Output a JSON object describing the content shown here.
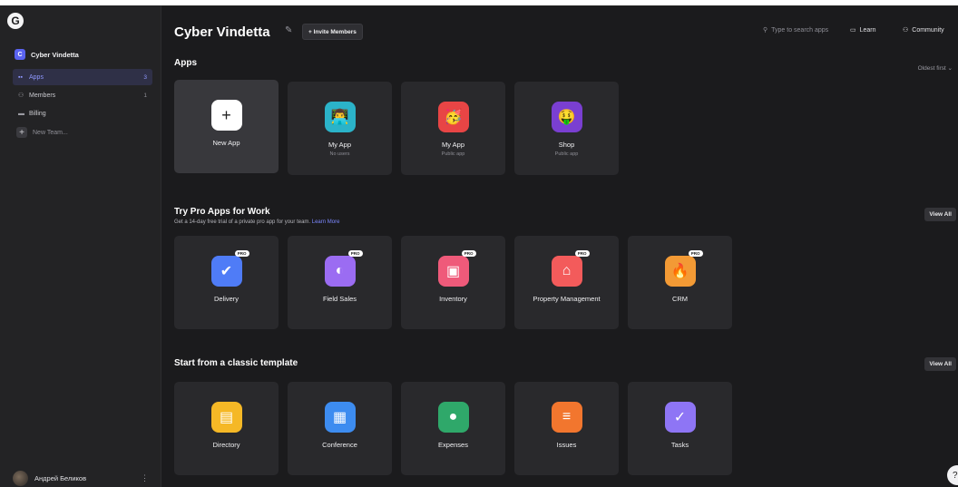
{
  "sidebar": {
    "logo": "G",
    "team": {
      "badge": "C",
      "name": "Cyber Vindetta"
    },
    "nav": [
      {
        "label": "Apps",
        "count": "3",
        "icon": "grid-icon"
      },
      {
        "label": "Members",
        "count": "1",
        "icon": "members-icon"
      },
      {
        "label": "Billing",
        "count": "",
        "icon": "billing-icon"
      }
    ],
    "new_team": "New Team...",
    "user": {
      "name": "Андрей Беликов",
      "menu": "⋮"
    }
  },
  "header": {
    "title": "Cyber Vindetta",
    "invite": "+ Invite Members",
    "search_placeholder": "Type to search apps",
    "learn": "Learn",
    "community": "Community"
  },
  "apps": {
    "title": "Apps",
    "sort": "Oldest first ⌄",
    "items": [
      {
        "label": "New App",
        "sub": "",
        "icon": "+"
      },
      {
        "label": "My App",
        "sub": "No users",
        "icon": "👨‍💻"
      },
      {
        "label": "My App",
        "sub": "Public app",
        "icon": "🥳"
      },
      {
        "label": "Shop",
        "sub": "Public app",
        "icon": "🤑"
      }
    ]
  },
  "pro": {
    "title": "Try Pro Apps for Work",
    "subtitle": "Get a 14-day free trial of a private pro app for your team.",
    "link": "Learn More",
    "view_all": "View All",
    "badge": "PRO",
    "items": [
      {
        "label": "Delivery",
        "color": "#4f7cf7",
        "icon": "✔"
      },
      {
        "label": "Field Sales",
        "color": "#9b6cf2",
        "icon": "◐"
      },
      {
        "label": "Inventory",
        "color": "#ef5a7a",
        "icon": "▣"
      },
      {
        "label": "Property Management",
        "color": "#f35b5b",
        "icon": "⌂"
      },
      {
        "label": "CRM",
        "color": "#f39a35",
        "icon": "🔥"
      }
    ]
  },
  "templates": {
    "title": "Start from a classic template",
    "view_all": "View All",
    "items": [
      {
        "label": "Directory",
        "color": "#f5b826",
        "icon": "▤"
      },
      {
        "label": "Conference",
        "color": "#3d8cf0",
        "icon": "▦"
      },
      {
        "label": "Expenses",
        "color": "#2fa86a",
        "icon": "●"
      },
      {
        "label": "Issues",
        "color": "#f2762e",
        "icon": "≡"
      },
      {
        "label": "Tasks",
        "color": "#8e75f5",
        "icon": "✓"
      }
    ]
  },
  "help": "?"
}
